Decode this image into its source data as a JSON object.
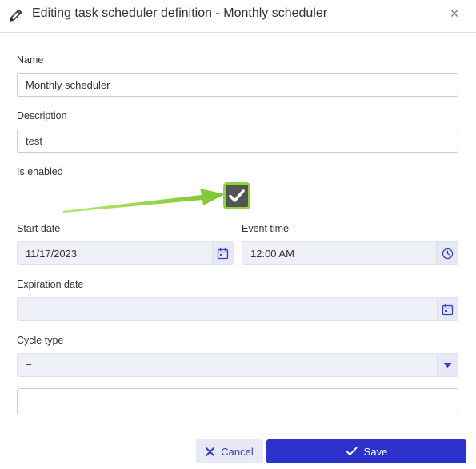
{
  "dialog": {
    "title": "Editing task scheduler definition - Monthly scheduler",
    "close_glyph": "×"
  },
  "form": {
    "name": {
      "label": "Name",
      "value": "Monthly scheduler"
    },
    "description": {
      "label": "Description",
      "value": "test"
    },
    "is_enabled": {
      "label": "Is enabled",
      "checked": true
    },
    "start_date": {
      "label": "Start date",
      "value": "11/17/2023"
    },
    "event_time": {
      "label": "Event time",
      "value": "12:00 AM"
    },
    "expiration_date": {
      "label": "Expiration date",
      "value": ""
    },
    "cycle_type": {
      "label": "Cycle type",
      "value": "–"
    },
    "extra_field": {
      "value": ""
    }
  },
  "buttons": {
    "cancel_label": "Cancel",
    "save_label": "Save"
  },
  "icons": [
    "pencil-icon",
    "close-icon",
    "check-icon",
    "calendar-icon",
    "clock-icon",
    "caret-down-icon",
    "x-icon",
    "arrow-annotation"
  ],
  "colors": {
    "accent": "#2b33cc",
    "checkbox_highlight": "#8bd43a",
    "checkbox_fill": "#545454",
    "annotation_arrow": "#8bd43a",
    "icon_blue": "#3b3fc9"
  }
}
